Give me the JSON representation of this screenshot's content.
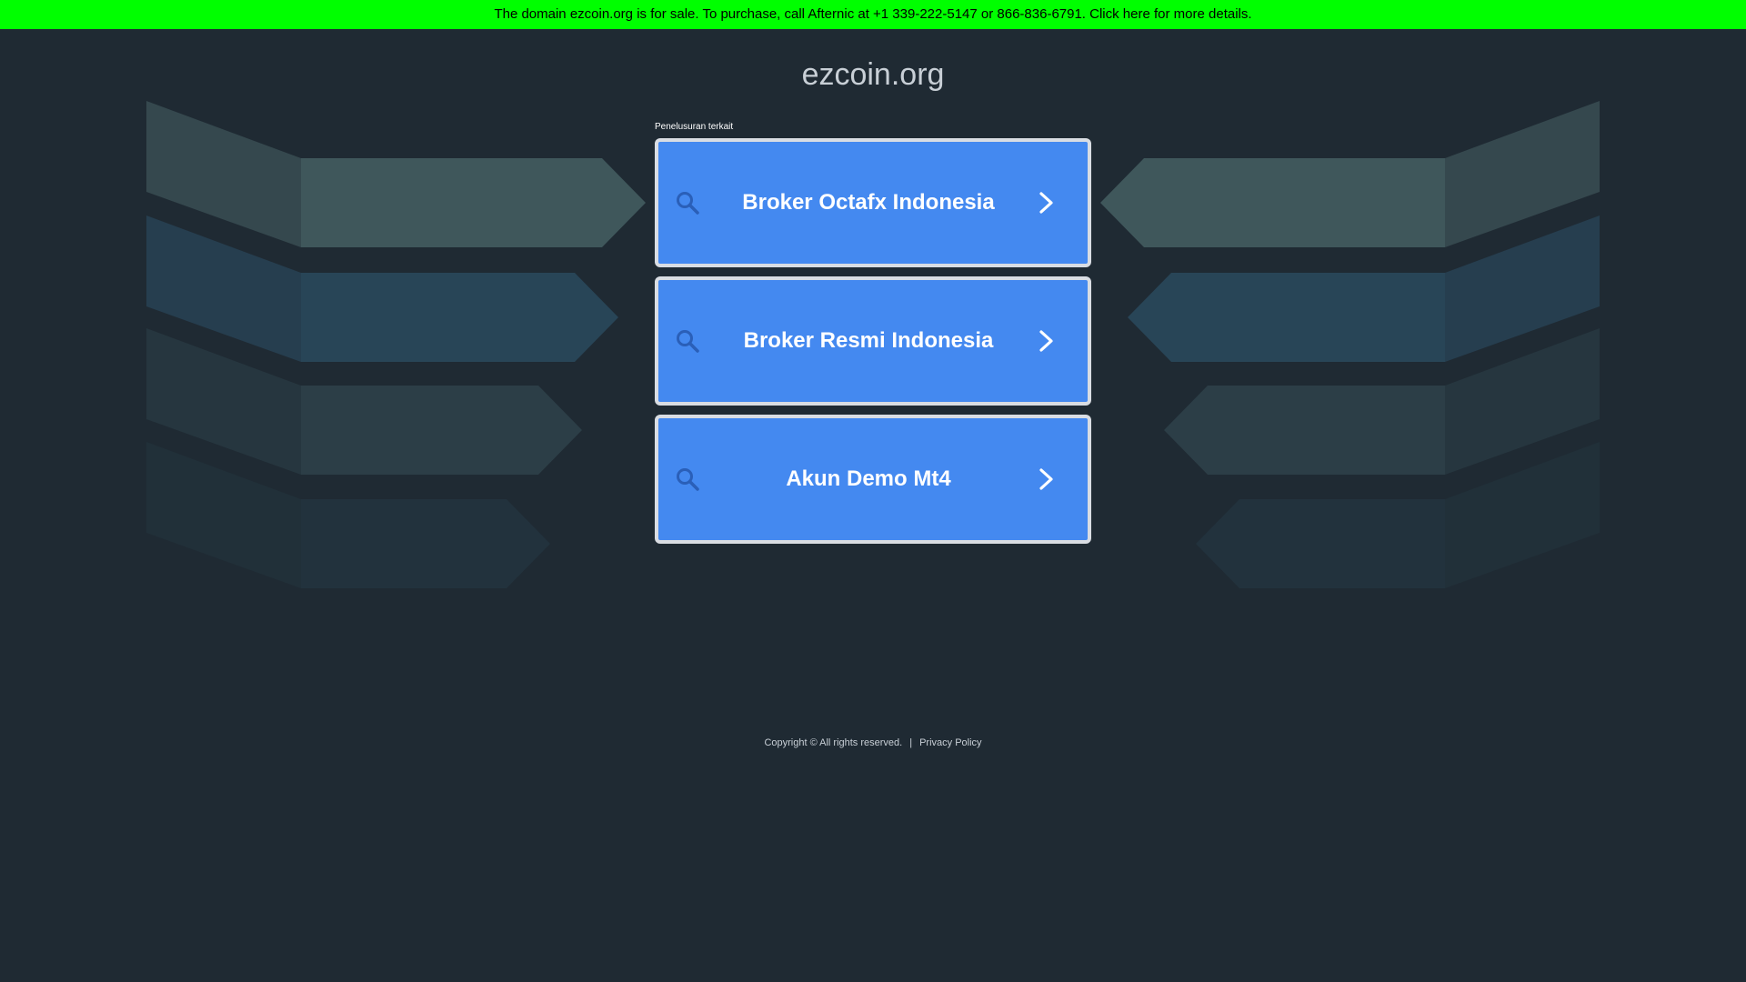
{
  "banner": {
    "text": "The domain ezcoin.org is for sale. To purchase, call Afternic at +1 339-222-5147 or 866-836-6791. Click here for more details.",
    "background": "#00ff00"
  },
  "site": {
    "title": "ezcoin.org"
  },
  "related": {
    "label": "Penelusuran terkait",
    "items": [
      {
        "label": "Broker Octafx Indonesia",
        "icon": "search-icon",
        "arrow": "chevron-right-icon"
      },
      {
        "label": "Broker Resmi Indonesia",
        "icon": "search-icon",
        "arrow": "chevron-right-icon"
      },
      {
        "label": "Akun Demo Mt4",
        "icon": "search-icon",
        "arrow": "chevron-right-icon"
      }
    ],
    "accent": "#4489f0"
  },
  "footer": {
    "copyright": "Copyright © All rights reserved.",
    "separator": "|",
    "privacy_link": "Privacy Policy"
  },
  "colors": {
    "page_background": "#1f2a33",
    "decor_teal": "#3f575b",
    "decor_blue": "#284557"
  }
}
